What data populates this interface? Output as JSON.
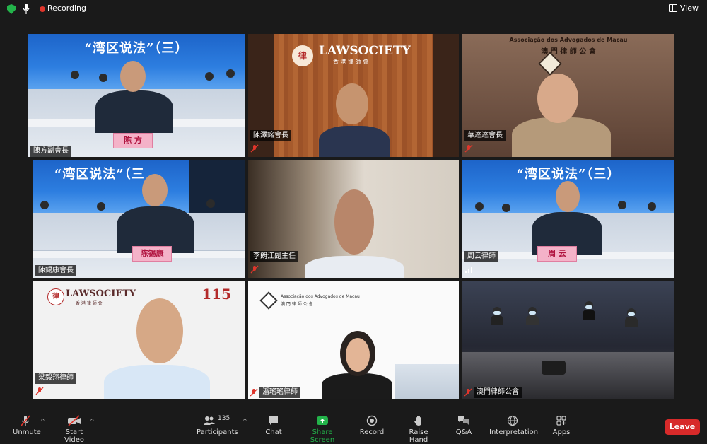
{
  "topbar": {
    "recording_label": "Recording",
    "view_label": "View"
  },
  "tiles": [
    {
      "name": "陳方副會長",
      "nameplate": "陈 方",
      "banner_title": "“湾区说法”（三）"
    },
    {
      "name": "陳澤銘會長",
      "logo_text": "LAWSOCIETY",
      "logo_sub": "香 港 律 師 會"
    },
    {
      "name": "華達達會長",
      "sign_text": "Associação dos Advogados de Macau",
      "sign_sub": "澳 門 律 師 公 會"
    },
    {
      "name": "陳錫康會長",
      "nameplate": "陈锡康",
      "banner_title": "“湾区说法”（三"
    },
    {
      "name": "李朗江副主任"
    },
    {
      "name": "周云律師",
      "nameplate": "周 云",
      "banner_title": "“湾区说法”（三）"
    },
    {
      "name": "梁毅翔律師",
      "logo_text": "LAWSOCIETY",
      "logo_sub": "香 港 律 師 會",
      "anniv": "115"
    },
    {
      "name": "潘瑤瑤律師",
      "sign_text": "Associação dos Advogados de Macau",
      "sign_sub": "澳 門 律 師 公 會"
    },
    {
      "name": "澳門律師公會"
    }
  ],
  "toolbar": {
    "unmute": "Unmute",
    "start_video": "Start Video",
    "participants": "Participants",
    "participants_count": "135",
    "chat": "Chat",
    "share_screen": "Share Screen",
    "record": "Record",
    "raise_hand": "Raise Hand",
    "qa": "Q&A",
    "interpretation": "Interpretation",
    "apps": "Apps",
    "leave": "Leave"
  },
  "colors": {
    "share_green": "#23b34a",
    "leave_red": "#d72a2a",
    "record_red": "#e0352b"
  }
}
